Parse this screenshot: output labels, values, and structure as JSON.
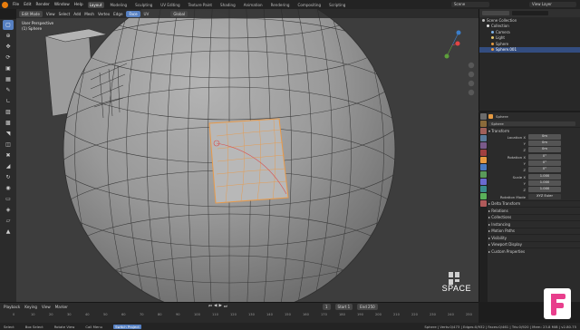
{
  "menu": {
    "items": [
      "File",
      "Edit",
      "Render",
      "Window",
      "Help"
    ]
  },
  "workspaces": [
    "Layout",
    "Modeling",
    "Sculpting",
    "UV Editing",
    "Texture Paint",
    "Shading",
    "Animation",
    "Rendering",
    "Compositing",
    "Scripting"
  ],
  "active_workspace": "Layout",
  "scene": "Scene",
  "view_layer": "View Layer",
  "viewport": {
    "mode": "Edit Mode",
    "menus": [
      "View",
      "Select",
      "Add",
      "Mesh",
      "Vertex",
      "Edge",
      "Face",
      "UV"
    ],
    "orientation": "Global",
    "info": [
      "User Perspective",
      "(1) Sphere"
    ],
    "overlay_text": "SPACE"
  },
  "outliner": {
    "items": [
      {
        "label": "Scene Collection",
        "color": "#bbbbbb",
        "indent": 0,
        "selected": false
      },
      {
        "label": "Collection",
        "color": "#e0e0e0",
        "indent": 1,
        "selected": false
      },
      {
        "label": "Camera",
        "color": "#7fb2e6",
        "indent": 2,
        "selected": false
      },
      {
        "label": "Light",
        "color": "#e6c86e",
        "indent": 2,
        "selected": false
      },
      {
        "label": "Sphere",
        "color": "#e69a42",
        "indent": 2,
        "selected": false
      },
      {
        "label": "Sphere.001",
        "color": "#e69a42",
        "indent": 2,
        "selected": true
      }
    ]
  },
  "properties": {
    "object_name": "Sphere",
    "field_name": "Sphere",
    "transform_label": "Transform",
    "location": {
      "label": "Location X",
      "x": "0m",
      "y": "0m",
      "z": "0m"
    },
    "rotation": {
      "label": "Rotation X",
      "x": "0°",
      "y": "0°",
      "z": "0°"
    },
    "scale": {
      "label": "Scale X",
      "x": "1.000",
      "y": "1.000",
      "z": "1.000"
    },
    "axis_labels": {
      "y": "Y",
      "z": "Z"
    },
    "rotation_mode": {
      "label": "Rotation Mode",
      "value": "XYZ Euler"
    },
    "sections": [
      "Delta Transform",
      "Relations",
      "Collections",
      "Instancing",
      "Motion Paths",
      "Visibility",
      "Viewport Display",
      "Custom Properties"
    ]
  },
  "timeline": {
    "menus": [
      "Playback",
      "Keying",
      "View",
      "Marker"
    ],
    "current_frame": "1",
    "start_label": "Start",
    "start": "1",
    "end_label": "End",
    "end": "250",
    "ticks": [
      "0",
      "10",
      "20",
      "30",
      "40",
      "50",
      "60",
      "70",
      "80",
      "90",
      "100",
      "110",
      "120",
      "130",
      "140",
      "150",
      "160",
      "170",
      "180",
      "190",
      "200",
      "210",
      "220",
      "230",
      "240",
      "250"
    ]
  },
  "status": {
    "items": [
      "Select",
      "Box Select",
      "Rotate View",
      "Call Menu",
      "Switch Project"
    ],
    "stats": "Sphere | Verts:0/473 | Edges:0/932 | Faces:0/461 | Tris:0/920 | Mem: 23.8 MiB | v2.80.75"
  },
  "colors": {
    "accent": "#5680c2",
    "selection": "#e89a4a",
    "brand": "#e83e8c",
    "mesh": "#9a9a9a"
  }
}
